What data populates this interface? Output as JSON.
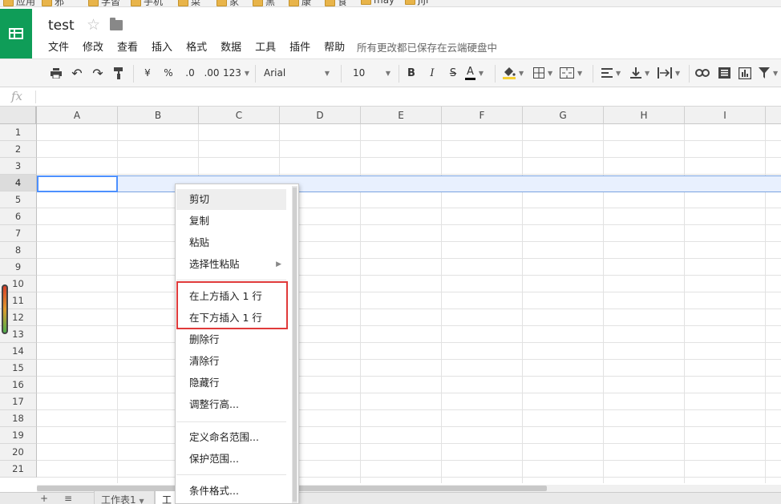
{
  "bookmarks": [
    "应用",
    "邪",
    "学習",
    "手机",
    "菜",
    "家",
    "黑",
    "康",
    "食",
    "may",
    "jiji"
  ],
  "document": {
    "title": "test",
    "save_status": "所有更改都已保存在云端硬盘中"
  },
  "menubar": [
    "文件",
    "修改",
    "查看",
    "插入",
    "格式",
    "数据",
    "工具",
    "插件",
    "帮助"
  ],
  "toolbar": {
    "currency": "¥",
    "percent": "%",
    "decimal_less": ".0",
    "decimal_more": ".00",
    "more_formats": "123",
    "font": "Arial",
    "font_size": "10",
    "bold": "B",
    "italic": "I",
    "strike": "S",
    "text_color": "A"
  },
  "formula_bar": {
    "fx_label": "fx",
    "value": ""
  },
  "columns": [
    "A",
    "B",
    "C",
    "D",
    "E",
    "F",
    "G",
    "H",
    "I"
  ],
  "rows": [
    "1",
    "2",
    "3",
    "4",
    "5",
    "6",
    "7",
    "8",
    "9",
    "10",
    "11",
    "12",
    "13",
    "14",
    "15",
    "16",
    "17",
    "18",
    "19",
    "20",
    "21"
  ],
  "selected_row": "4",
  "context_menu": {
    "items": [
      {
        "label": "剪切"
      },
      {
        "label": "复制"
      },
      {
        "label": "粘贴"
      },
      {
        "label": "选择性粘贴",
        "submenu_arrow": "▶"
      },
      {
        "label": "在上方插入 1 行"
      },
      {
        "label": "在下方插入 1 行"
      },
      {
        "label": "删除行"
      },
      {
        "label": "清除行"
      },
      {
        "label": "隐藏行"
      },
      {
        "label": "调整行高..."
      },
      {
        "label": "定义命名范围..."
      },
      {
        "label": "保护范围..."
      },
      {
        "label": "条件格式..."
      }
    ]
  },
  "sheets": [
    {
      "label": "工作表1"
    },
    {
      "label": "工作"
    }
  ],
  "sheet_controls": {
    "add": "+",
    "list": "≡"
  },
  "colors": {
    "brand_green": "#0f9d58",
    "selection_blue": "#4d90fe",
    "highlight_red": "#e03a3a"
  }
}
